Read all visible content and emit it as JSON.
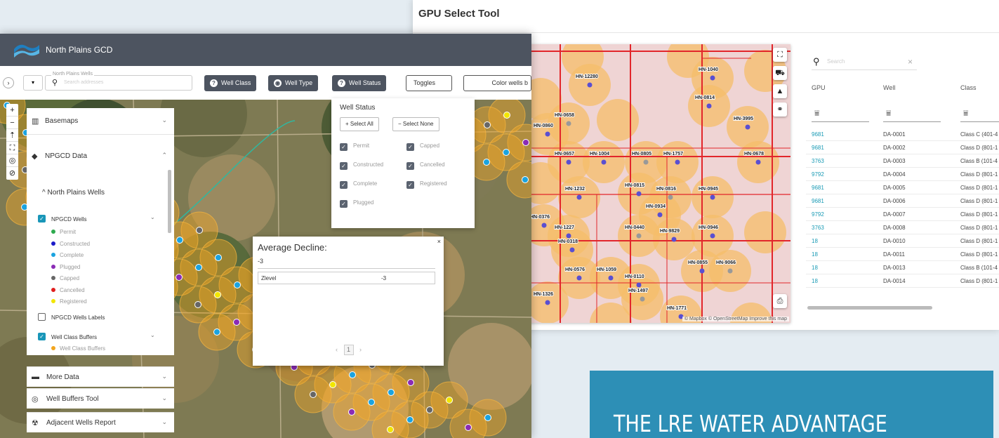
{
  "gpu_tool": {
    "title": "GPU Select Tool",
    "search_placeholder": "Search",
    "columns": [
      "GPU",
      "Well",
      "Class"
    ],
    "rows": [
      [
        "9681",
        "DA-0001",
        "Class C (401-4"
      ],
      [
        "9681",
        "DA-0002",
        "Class D (801-1"
      ],
      [
        "3763",
        "DA-0003",
        "Class B (101-4"
      ],
      [
        "9792",
        "DA-0004",
        "Class D (801-1"
      ],
      [
        "9681",
        "DA-0005",
        "Class D (801-1"
      ],
      [
        "9681",
        "DA-0006",
        "Class D (801-1"
      ],
      [
        "9792",
        "DA-0007",
        "Class D (801-1"
      ],
      [
        "3763",
        "DA-0008",
        "Class D (801-1"
      ],
      [
        "18",
        "DA-0010",
        "Class D (801-1"
      ],
      [
        "18",
        "DA-0011",
        "Class D (801-1"
      ],
      [
        "18",
        "DA-0013",
        "Class B (101-4"
      ],
      [
        "18",
        "DA-0014",
        "Class D (801-1"
      ]
    ],
    "map_labels": [
      "HN-12280",
      "HN-1040",
      "HN-0814",
      "HN-0658",
      "HN-0860",
      "HN-3995",
      "HN-0657",
      "HN-1004",
      "HN-0805",
      "HN-1757",
      "HN-0678",
      "HN-1232",
      "HN-0815",
      "HN-0816",
      "HN-0945",
      "HN-0376",
      "HN-0934",
      "HN-1227",
      "HN-0440",
      "HN-9829",
      "HN-0946",
      "HN-0318",
      "HN-0855",
      "HN-9066",
      "HN-0576",
      "HN-1059",
      "HN-0110",
      "HN-1326",
      "HN-1497",
      "HN-1771"
    ],
    "attribution": "© Mapbox © OpenStreetMap Improve this map"
  },
  "np_app": {
    "title": "North Plains GCD",
    "search_label": "North Plains Wells",
    "search_placeholder": "Search addresses",
    "buttons": {
      "well_class": "Well Class",
      "well_type": "Well Type",
      "well_status": "Well Status",
      "toggles": "Toggles",
      "color_wells": "Color wells b"
    },
    "panels": {
      "basemaps": "Basemaps",
      "npgcd_data": "NPGCD Data",
      "north_plains_wells": "North Plains Wells",
      "npgcd_wells": "NPGCD Wells",
      "npgcd_wells_labels": "NPGCD Wells Labels",
      "well_class_buffers": "Well Class Buffers",
      "well_class_buffers_legend": "Well Class Buffers",
      "more_data": "More Data",
      "well_buffers_tool": "Well Buffers Tool",
      "adjacent_wells_report": "Adjacent Wells Report"
    },
    "legend": [
      {
        "label": "Permit",
        "color": "#2eaa4f"
      },
      {
        "label": "Constructed",
        "color": "#1c1cc9"
      },
      {
        "label": "Complete",
        "color": "#1aa3e0"
      },
      {
        "label": "Plugged",
        "color": "#8a2bb5"
      },
      {
        "label": "Capped",
        "color": "#666666"
      },
      {
        "label": "Cancelled",
        "color": "#e01e1e"
      },
      {
        "label": "Registered",
        "color": "#f2e600"
      }
    ],
    "well_status_panel": {
      "title": "Well Status",
      "select_all": "Select All",
      "select_none": "Select None",
      "items": [
        "Permit",
        "Capped",
        "Constructed",
        "Cancelled",
        "Complete",
        "Registered",
        "Plugged"
      ]
    },
    "popup": {
      "title": "Average Decline:",
      "value": "-3",
      "row_key": "Zlevel",
      "row_value": "-3",
      "page": "1"
    }
  },
  "banner": {
    "text": "THE LRE WATER ADVANTAGE"
  }
}
